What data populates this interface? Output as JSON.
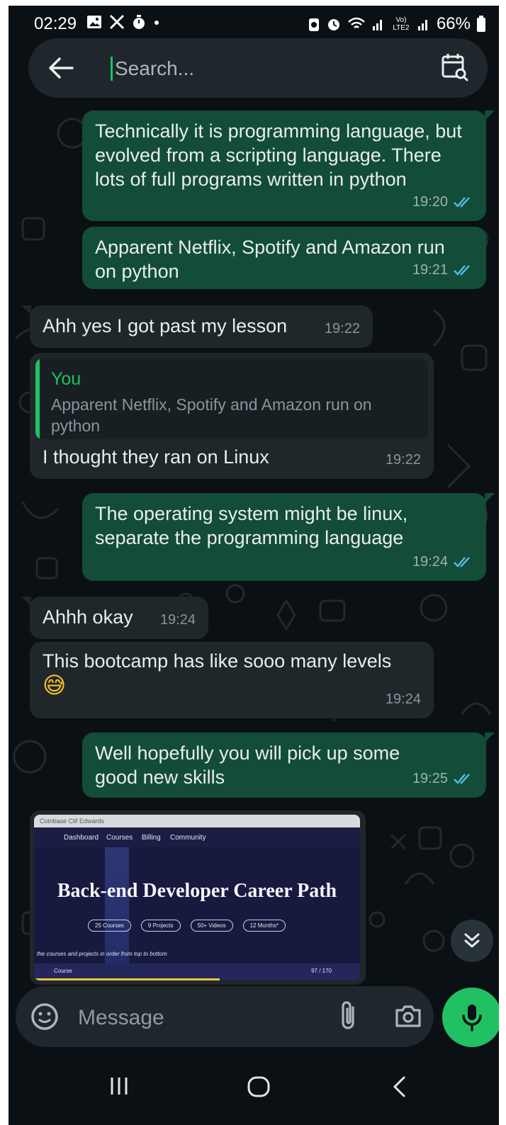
{
  "status_bar": {
    "time": "02:29",
    "battery": "66%",
    "network": "Vo) LTE2"
  },
  "search": {
    "placeholder": "Search..."
  },
  "messages": [
    {
      "direction": "out",
      "text": "Technically it is programming language, but evolved from a scripting language. There lots of full programs written in python",
      "time": "19:20",
      "status": "read"
    },
    {
      "direction": "out",
      "text": "Apparent Netflix, Spotify and Amazon run on python",
      "time": "19:21",
      "status": "read"
    },
    {
      "direction": "in",
      "text": "Ahh yes I got past my lesson",
      "time": "19:22"
    },
    {
      "direction": "in",
      "quote_author": "You",
      "quote_text": "Apparent Netflix, Spotify and Amazon run on python",
      "text": "I thought they ran on Linux",
      "time": "19:22"
    },
    {
      "direction": "out",
      "text": "The operating system might be linux, separate the programming language",
      "time": "19:24",
      "status": "read"
    },
    {
      "direction": "in",
      "text": "Ahhh okay",
      "time": "19:24"
    },
    {
      "direction": "in",
      "text": "This bootcamp has like sooo many levels",
      "emoji": "😅",
      "time": "19:24"
    },
    {
      "direction": "out",
      "text": "Well hopefully you will pick up some good new skills",
      "time": "19:25",
      "status": "read"
    }
  ],
  "image_message": {
    "direction": "in",
    "bookmarks": "Coinbase  Clif Edwards",
    "nav": [
      "Dashboard",
      "Courses",
      "Billing",
      "Community"
    ],
    "title": "Back-end Developer Career Path",
    "pills": [
      "25 Courses",
      "9 Projects",
      "50+ Videos",
      "12 Months*"
    ],
    "hint": "the courses and projects in order from top to bottom",
    "row_label": "Course",
    "progress_text": "97 / 170",
    "progress": 0.57
  },
  "composer": {
    "placeholder": "Message"
  },
  "colors": {
    "background": "#0b1014",
    "outgoing_bubble": "#134d37",
    "incoming_bubble": "#1f272a",
    "accent": "#21c063",
    "read_ticks": "#53bdeb"
  },
  "icons": [
    "back-arrow-icon",
    "calendar-search-icon",
    "double-check-icon",
    "chevron-double-down-icon",
    "sticker-icon",
    "paperclip-icon",
    "camera-icon",
    "microphone-icon",
    "recents-icon",
    "home-icon",
    "back-nav-icon"
  ]
}
